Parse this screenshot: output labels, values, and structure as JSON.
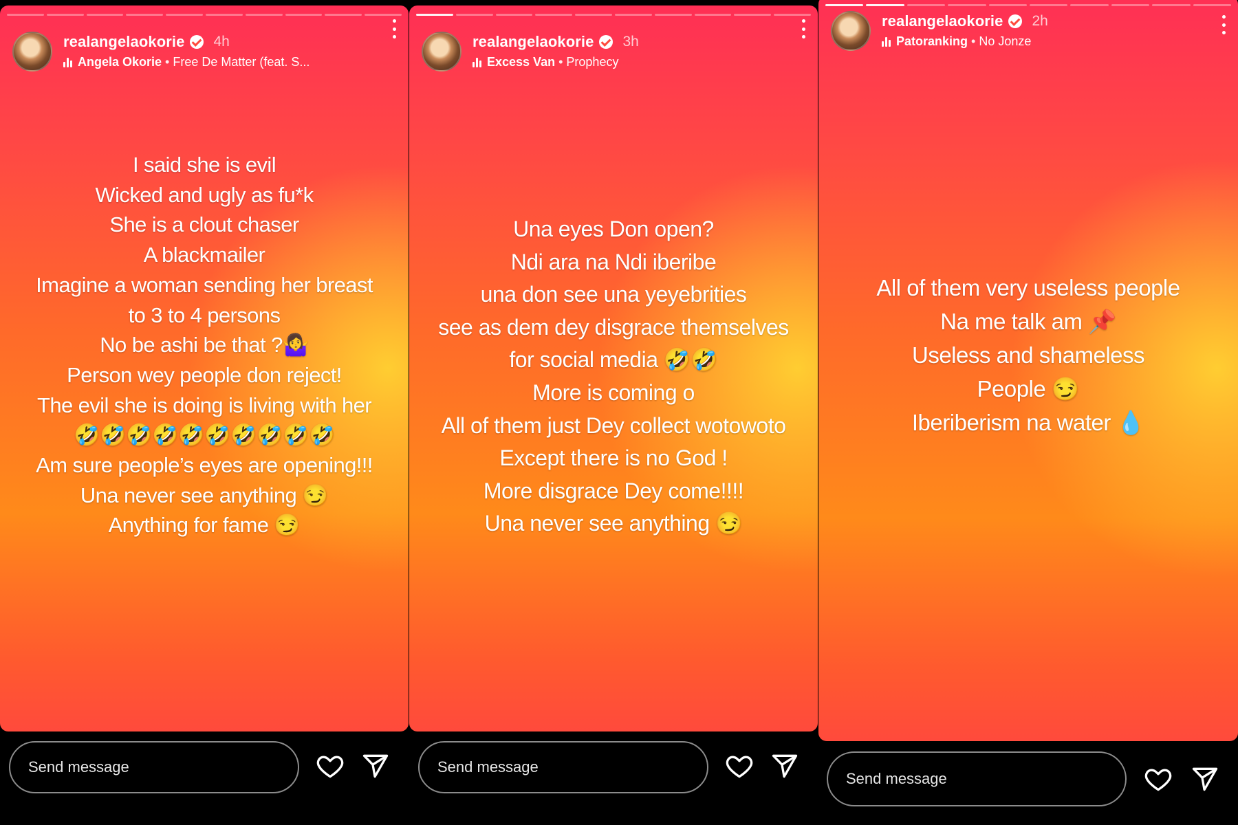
{
  "stories": [
    {
      "username": "realangelaokorie",
      "time": "4h",
      "music_artist": "Angela Okorie",
      "music_separator": " • ",
      "music_track": "Free De Matter (feat. S...",
      "segments_total": 10,
      "segments_done": 0,
      "lines": [
        "I said she is evil",
        "Wicked and ugly as fu*k",
        "She is a clout chaser",
        "A blackmailer",
        "Imagine a woman sending her breast",
        "to 3 to 4 persons",
        "No be ashi be that ?🤷‍♀️",
        "Person wey people don reject!",
        "The evil she is doing is living with her",
        "🤣🤣🤣🤣🤣🤣🤣🤣🤣🤣",
        "Am sure people’s eyes are opening!!!",
        "Una never see anything 😏",
        "Anything for fame 😏"
      ],
      "send_placeholder": "Send message"
    },
    {
      "username": "realangelaokorie",
      "time": "3h",
      "music_artist": "Excess Van",
      "music_separator": " • ",
      "music_track": "Prophecy",
      "segments_total": 10,
      "segments_done": 1,
      "lines": [
        "Una eyes Don open?",
        "Ndi ara na Ndi iberibe",
        "una don see una yeyebrities",
        "see as dem dey disgrace themselves",
        "for social media 🤣🤣",
        "More is coming o",
        "All of them just Dey collect wotowoto",
        "Except there is no God !",
        "More disgrace Dey come!!!!",
        "Una never see anything 😏"
      ],
      "send_placeholder": "Send message"
    },
    {
      "username": "realangelaokorie",
      "time": "2h",
      "music_artist": "Patoranking",
      "music_separator": " • ",
      "music_track": "No Jonze",
      "segments_total": 10,
      "segments_done": 2,
      "lines": [
        "All of them very useless people",
        "Na me talk am 📌",
        "Useless and shameless",
        "People 😏",
        "Iberiberism na water 💧"
      ],
      "send_placeholder": "Send message"
    }
  ]
}
